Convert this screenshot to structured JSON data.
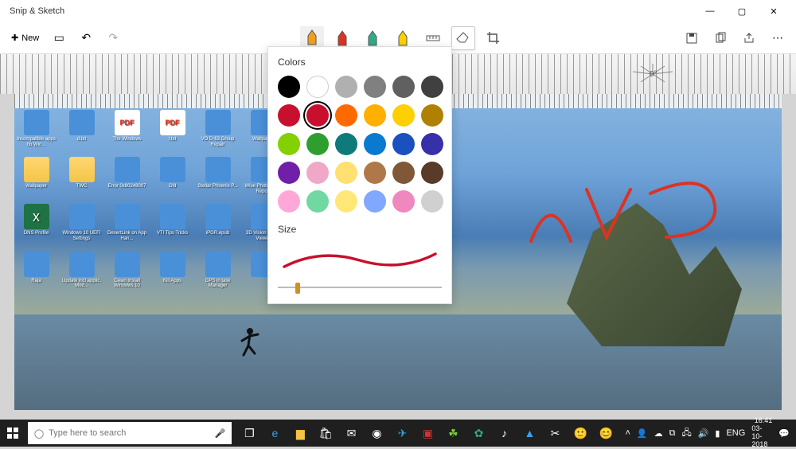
{
  "app": {
    "title": "Snip & Sketch"
  },
  "toolbar": {
    "new_label": "New",
    "tools": [
      "ballpoint-pen",
      "pencil",
      "highlighter",
      "marker",
      "ruler",
      "eraser",
      "crop"
    ]
  },
  "ruler": {
    "angle": "0°"
  },
  "color_popup": {
    "colors_label": "Colors",
    "size_label": "Size",
    "selected_color": "#c8102e",
    "colors": [
      "#000000",
      "#ffffff",
      "#b0b0b0",
      "#808080",
      "#606060",
      "#404040",
      "#c8102e",
      "#c8102e",
      "#ff6a00",
      "#ffb000",
      "#ffd000",
      "#b08000",
      "#84d000",
      "#2e9e2e",
      "#0e7a7a",
      "#0a7ad0",
      "#1a50c0",
      "#3830a8",
      "#7020a8",
      "#f0a8c8",
      "#ffe070",
      "#b07848",
      "#805838",
      "#5a3a28",
      "#ffa8d8",
      "#70d8a0",
      "#ffe878",
      "#80a8ff",
      "#f088c0",
      "#d0d0d0"
    ],
    "selected_index": 7,
    "size_value": 12
  },
  "desktop_icons": [
    {
      "label": "Incompatible apps no Win...",
      "type": "generic"
    },
    {
      "label": "d.txt",
      "type": "generic"
    },
    {
      "label": "The Windows",
      "type": "pdf"
    },
    {
      "label": "t.txt",
      "type": "pdf"
    },
    {
      "label": "VO D-63 Group Repair",
      "type": "generic"
    },
    {
      "label": "Wallpaper",
      "type": "generic"
    },
    {
      "label": "Wallpaper",
      "type": "folder"
    },
    {
      "label": "TWC",
      "type": "folder"
    },
    {
      "label": "Error 0x80248007",
      "type": "generic"
    },
    {
      "label": "Gfd",
      "type": "generic"
    },
    {
      "label": "Stellar Phoenix P...",
      "type": "generic"
    },
    {
      "label": "Wise Photo Scan Report",
      "type": "generic"
    },
    {
      "label": "DNS Profile",
      "type": "excel"
    },
    {
      "label": "Windows 10 UEFI Settings",
      "type": "generic"
    },
    {
      "label": "DesertLink on App Han...",
      "type": "generic"
    },
    {
      "label": "VTI Tips Tricks",
      "type": "generic"
    },
    {
      "label": "iPGR.epub",
      "type": "generic"
    },
    {
      "label": "3D Vision Photo Viewer",
      "type": "generic"
    },
    {
      "label": "Raja",
      "type": "generic"
    },
    {
      "label": "Update incl applic. Mod...",
      "type": "generic"
    },
    {
      "label": "Clean Install Windows 10",
      "type": "generic"
    },
    {
      "label": "Kill Apps",
      "type": "generic"
    },
    {
      "label": "GPS in task Manager",
      "type": "generic"
    },
    {
      "label": "",
      "type": "generic"
    }
  ],
  "taskbar": {
    "search_placeholder": "Type here to search",
    "tray": {
      "lang": "ENG",
      "time": "16:41",
      "date": "03-10-2018"
    }
  }
}
